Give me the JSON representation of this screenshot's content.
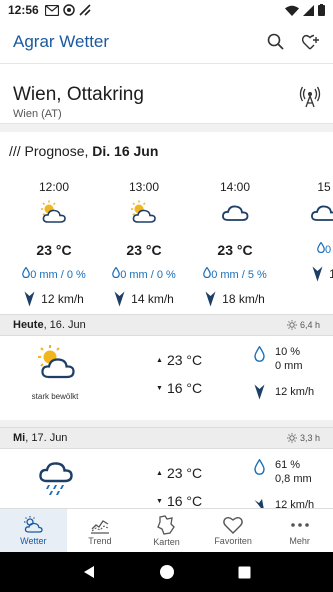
{
  "status_bar": {
    "time": "12:56"
  },
  "app": {
    "title": "Agrar Wetter"
  },
  "location": {
    "city": "Wien, Ottakring",
    "region": "Wien (AT)"
  },
  "forecast": {
    "prefix": "/// Prognose, ",
    "day": "Di. 16 Jun",
    "hours": [
      {
        "time": "12:00",
        "icon": "partly-sunny-icon",
        "temp": "23 °C",
        "rain": "0 mm / 0 %",
        "wind": "12 km/h"
      },
      {
        "time": "13:00",
        "icon": "partly-sunny-icon",
        "temp": "23 °C",
        "rain": "0 mm / 0 %",
        "wind": "14 km/h"
      },
      {
        "time": "14:00",
        "icon": "cloudy-icon",
        "temp": "23 °C",
        "rain": "0 mm / 5 %",
        "wind": "18 km/h"
      },
      {
        "time": "15",
        "icon": "cloudy-icon",
        "temp": "",
        "rain": "0",
        "wind": "1"
      }
    ]
  },
  "days": [
    {
      "day": "Heute",
      "date": ", 16. Jun",
      "uv": "6,4 h",
      "icon": "partly-sunny-icon",
      "desc": "stark bewölkt",
      "tmax": "23 °C",
      "tmin": "16 °C",
      "prob": "10 %",
      "amount": "0 mm",
      "wind": "12 km/h"
    },
    {
      "day": "Mi",
      "date": ", 17. Jun",
      "uv": "3,3 h",
      "icon": "rain-cloud-icon",
      "desc": "",
      "tmax": "23 °C",
      "tmin": "16 °C",
      "prob": "61 %",
      "amount": "0,8 mm",
      "wind": "12 km/h"
    }
  ],
  "nav": [
    {
      "label": "Wetter",
      "icon": "weather-icon",
      "active": true
    },
    {
      "label": "Trend",
      "icon": "trend-icon",
      "active": false
    },
    {
      "label": "Karten",
      "icon": "map-icon",
      "active": false
    },
    {
      "label": "Favoriten",
      "icon": "heart-icon",
      "active": false
    },
    {
      "label": "Mehr",
      "icon": "more-icon",
      "active": false
    }
  ],
  "colors": {
    "accent": "#1b5aa0",
    "rain": "#1b6fb8",
    "sun": "#f2b51e",
    "cloud": "#1d3f66"
  }
}
